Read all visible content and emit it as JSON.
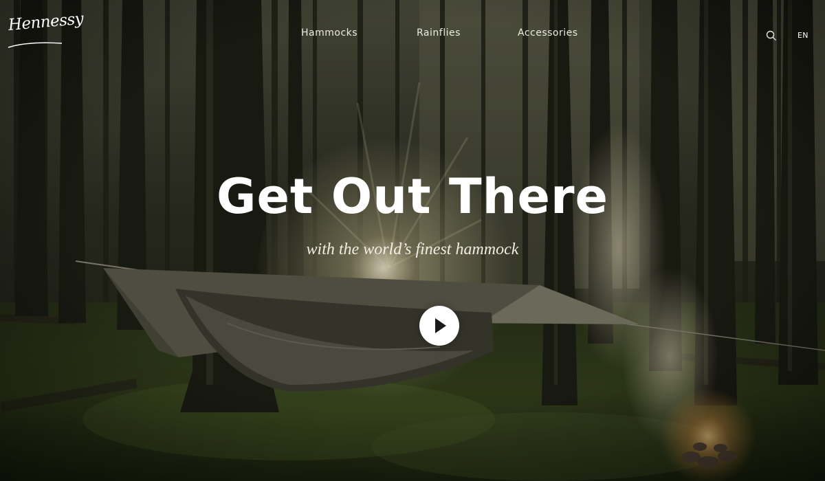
{
  "brand": {
    "logo_text": "Hennessy"
  },
  "nav": {
    "items": [
      {
        "label": "Hammocks"
      },
      {
        "label": "Rainflies"
      },
      {
        "label": "Accessories"
      }
    ],
    "search_icon": "search-icon",
    "language": "EN"
  },
  "hero": {
    "title": "Get Out There",
    "subtitle": "with the world’s finest hammock",
    "play_icon": "play-icon",
    "background": "forest-hammock-campfire-photo"
  },
  "colors": {
    "overlay_text": "#ffffff",
    "forest_dark": "#1b1d14",
    "moss": "#3e4d24",
    "tarp": "#5a5848"
  }
}
